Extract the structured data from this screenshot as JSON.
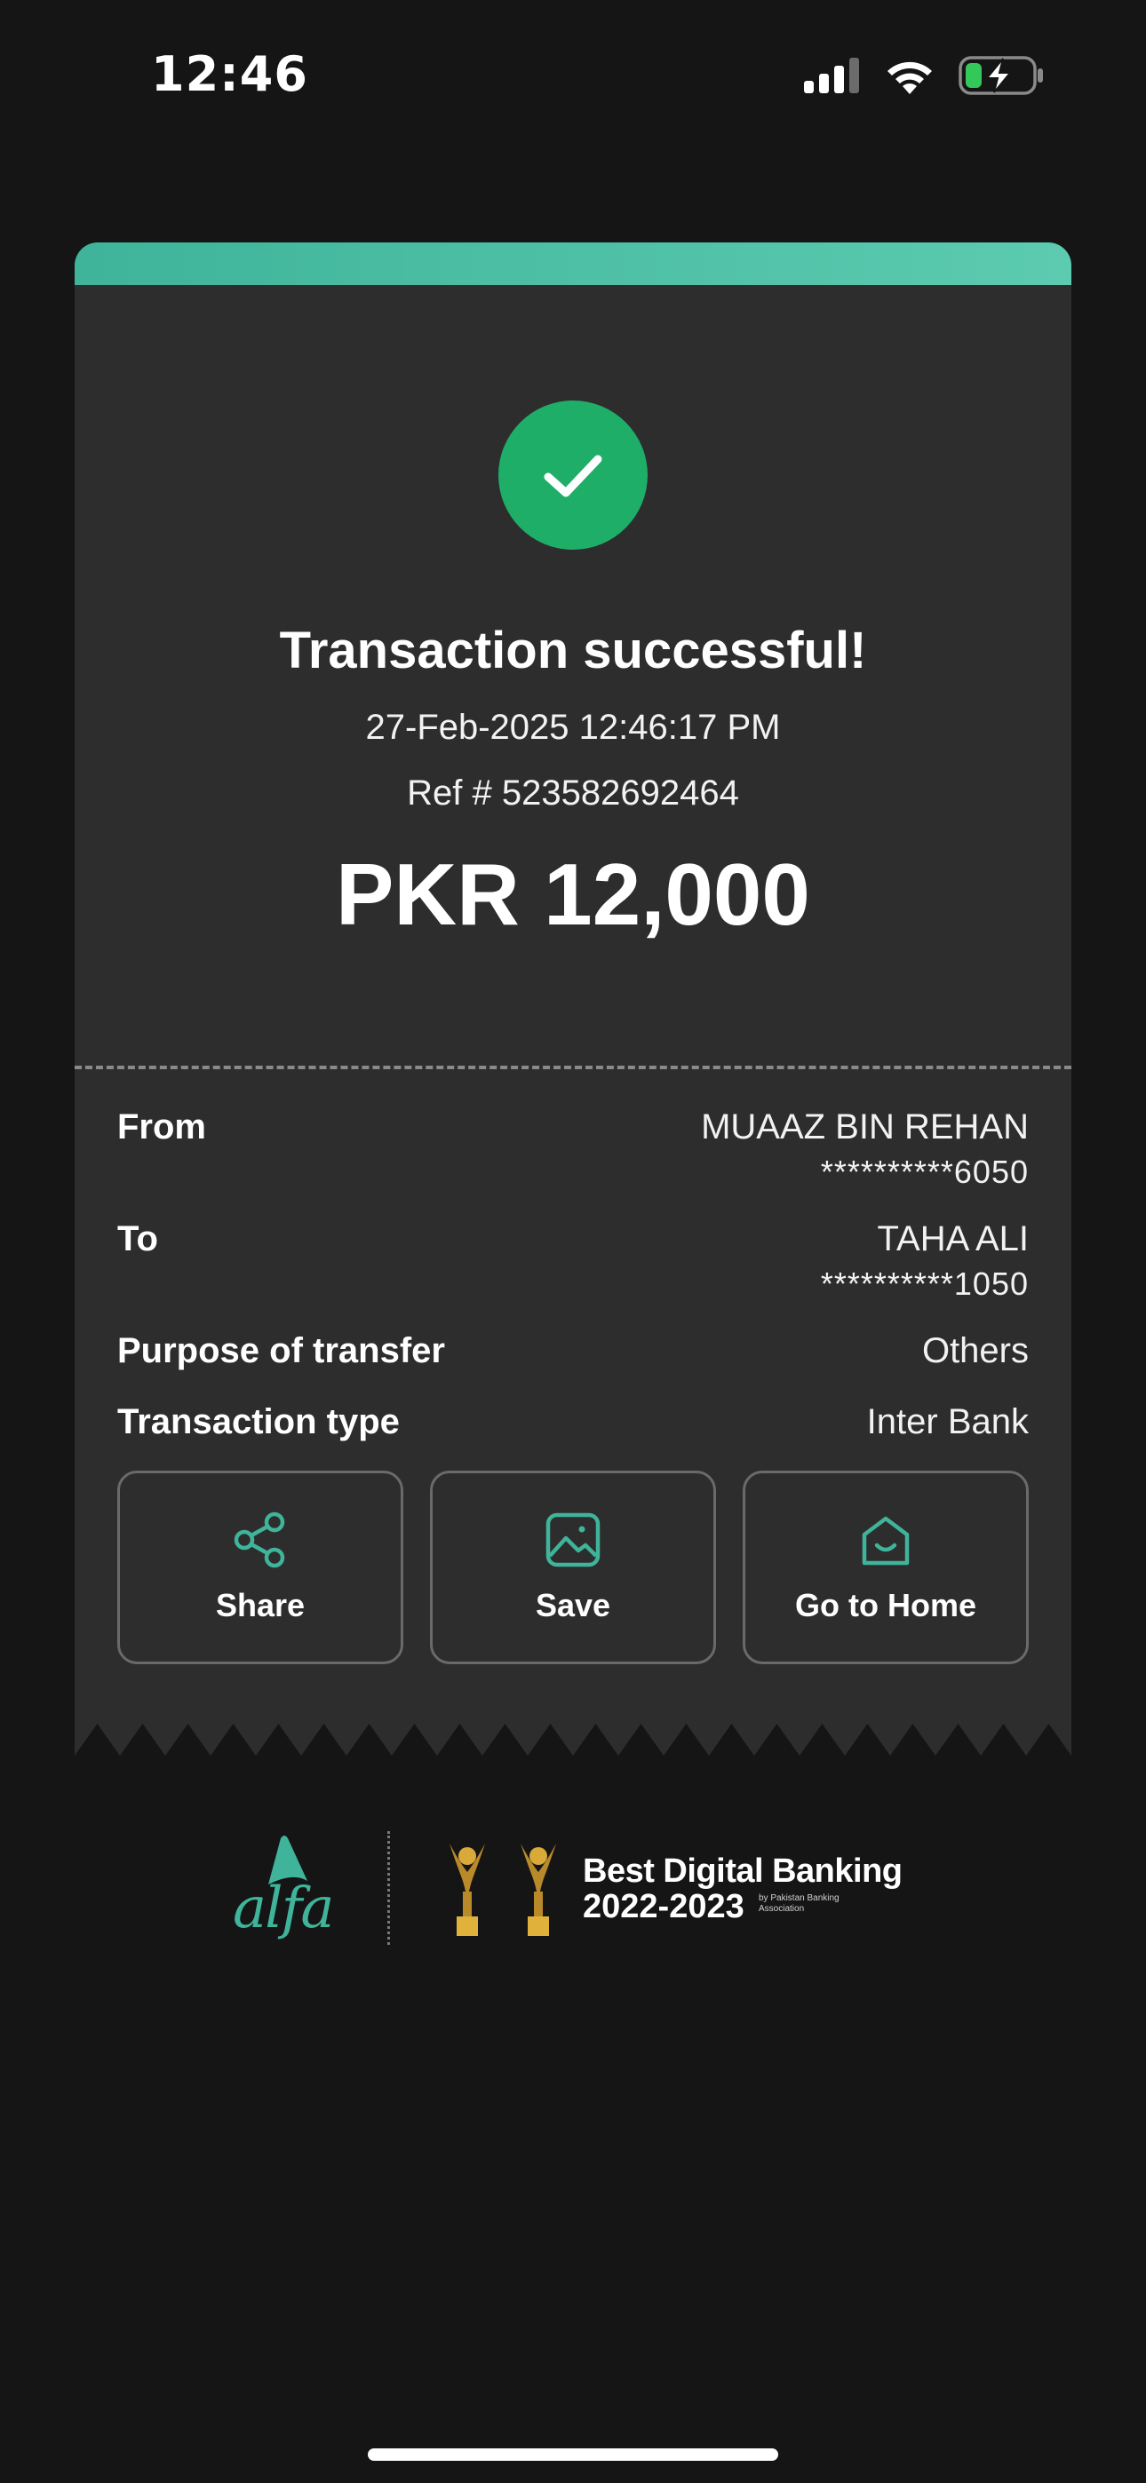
{
  "status_bar": {
    "time": "12:46",
    "icons": [
      "signal-icon",
      "wifi-icon",
      "battery-charging-icon"
    ]
  },
  "receipt": {
    "title": "Transaction successful!",
    "datetime": "27-Feb-2025 12:46:17 PM",
    "ref": "Ref # 523582692464",
    "amount": "PKR 12,000",
    "details": {
      "from": {
        "label": "From",
        "name": "MUAAZ BIN REHAN",
        "account": "**********6050"
      },
      "to": {
        "label": "To",
        "name": "TAHA ALI",
        "account": "**********1050"
      },
      "purpose": {
        "label": "Purpose of transfer",
        "value": "Others"
      },
      "type": {
        "label": "Transaction type",
        "value": "Inter Bank"
      }
    },
    "actions": [
      {
        "label": "Share",
        "icon": "share-icon"
      },
      {
        "label": "Save",
        "icon": "image-icon"
      },
      {
        "label": "Go to Home",
        "icon": "home-icon"
      }
    ]
  },
  "footer": {
    "brand": "alfa",
    "award_title": "Best Digital Banking",
    "award_years": "2022-2023",
    "award_by": "by Pakistan Banking Association"
  },
  "colors": {
    "accent": "#3fb49a",
    "success": "#1fae68",
    "background": "#151515",
    "card": "#2d2d2d"
  }
}
